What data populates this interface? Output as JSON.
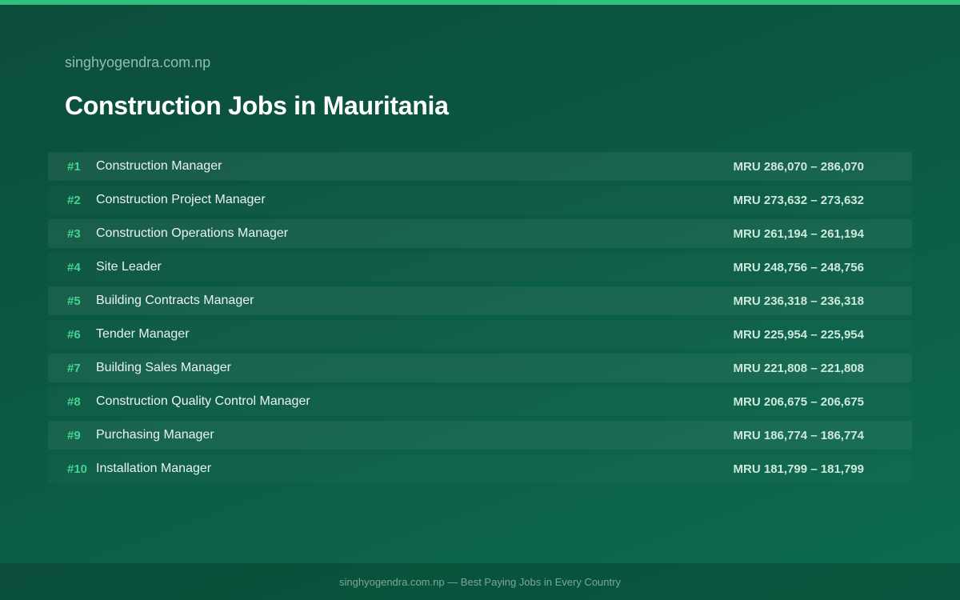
{
  "header": {
    "site": "singhyogendra.com.np",
    "title": "Construction Jobs in Mauritania"
  },
  "jobs": [
    {
      "rank": "#1",
      "title": "Construction Manager",
      "salary": "MRU 286,070 – 286,070"
    },
    {
      "rank": "#2",
      "title": "Construction Project Manager",
      "salary": "MRU 273,632 – 273,632"
    },
    {
      "rank": "#3",
      "title": "Construction Operations Manager",
      "salary": "MRU 261,194 – 261,194"
    },
    {
      "rank": "#4",
      "title": "Site Leader",
      "salary": "MRU 248,756 – 248,756"
    },
    {
      "rank": "#5",
      "title": "Building Contracts Manager",
      "salary": "MRU 236,318 – 236,318"
    },
    {
      "rank": "#6",
      "title": "Tender Manager",
      "salary": "MRU 225,954 – 225,954"
    },
    {
      "rank": "#7",
      "title": "Building Sales Manager",
      "salary": "MRU 221,808 – 221,808"
    },
    {
      "rank": "#8",
      "title": "Construction Quality Control Manager",
      "salary": "MRU 206,675 – 206,675"
    },
    {
      "rank": "#9",
      "title": "Purchasing Manager",
      "salary": "MRU 186,774 – 186,774"
    },
    {
      "rank": "#10",
      "title": "Installation Manager",
      "salary": "MRU 181,799 – 181,799"
    }
  ],
  "footer": {
    "text": "singhyogendra.com.np — Best Paying Jobs in Every Country"
  },
  "colors": {
    "accent": "#2fbf7f",
    "rank": "#45d490",
    "background": "#0b5a44"
  }
}
